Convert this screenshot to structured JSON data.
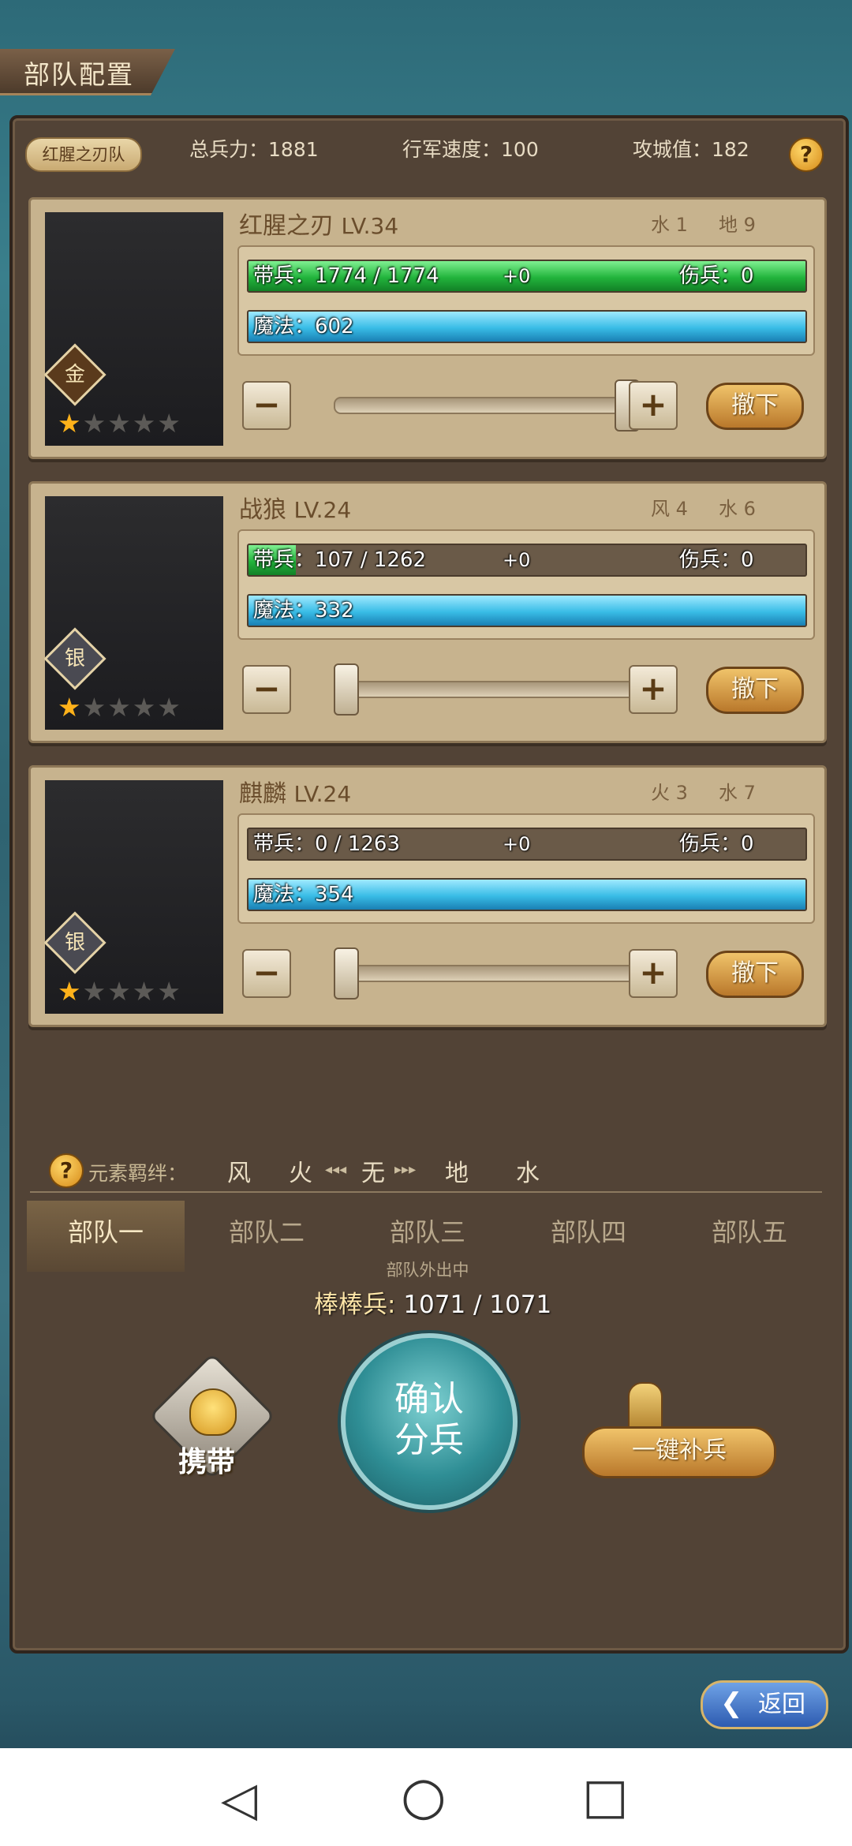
{
  "title": "部队配置",
  "header": {
    "team_name": "红腥之刃队",
    "total_troops_label": "总兵力：",
    "total_troops": "1881",
    "march_speed_label": "行军速度：",
    "march_speed": "100",
    "siege_label": "攻城值：",
    "siege_value": "182",
    "help_glyph": "?"
  },
  "units": [
    {
      "name": "红腥之刃",
      "level": "LV.34",
      "rank": "金",
      "elem1": "水 1",
      "elem2": "地 9",
      "troops_text": "带兵：1774 / 1774",
      "troops_fill": 1.0,
      "bonus": "+0",
      "wounded": "伤兵：0",
      "mana": "魔法：602",
      "mana_fill": 1.0,
      "slider_level": 1.0,
      "stars_filled": 1,
      "stars_total": 5,
      "withdraw": "撤下",
      "minus": "−",
      "plus": "+"
    },
    {
      "name": "战狼",
      "level": "LV.24",
      "rank": "银",
      "elem1": "风 4",
      "elem2": "水 6",
      "troops_text": "带兵：107 / 1262",
      "troops_fill": 0.085,
      "bonus": "+0",
      "wounded": "伤兵：0",
      "mana": "魔法：332",
      "mana_fill": 1.0,
      "slider_level": 0.0,
      "stars_filled": 1,
      "stars_total": 5,
      "withdraw": "撤下",
      "minus": "−",
      "plus": "+"
    },
    {
      "name": "麒麟",
      "level": "LV.24",
      "rank": "银",
      "elem1": "火 3",
      "elem2": "水 7",
      "troops_text": "带兵：0 / 1263",
      "troops_fill": 0.0,
      "bonus": "+0",
      "wounded": "伤兵：0",
      "mana": "魔法：354",
      "mana_fill": 1.0,
      "slider_level": 0.0,
      "stars_filled": 1,
      "stars_total": 5,
      "withdraw": "撤下",
      "minus": "−",
      "plus": "+"
    }
  ],
  "bond": {
    "label": "元素羁绊：",
    "elements": [
      "风",
      "火",
      "无",
      "地",
      "水"
    ]
  },
  "tabs": [
    "部队一",
    "部队二",
    "部队三",
    "部队四",
    "部队五"
  ],
  "active_tab": 0,
  "status": "部队外出中",
  "stick_troops_label": "棒棒兵:",
  "stick_troops_value": "1071 / 1071",
  "carry_label": "携带",
  "confirm_line1": "确认",
  "confirm_line2": "分兵",
  "refill_label": "一键补兵",
  "back_label": "返回",
  "nav": {
    "back": "◁",
    "home": "○",
    "recent": "□"
  },
  "colors": {
    "troops_bar": "#22b43c",
    "mana_bar": "#38bce6",
    "star_on": "#ffb21a"
  }
}
